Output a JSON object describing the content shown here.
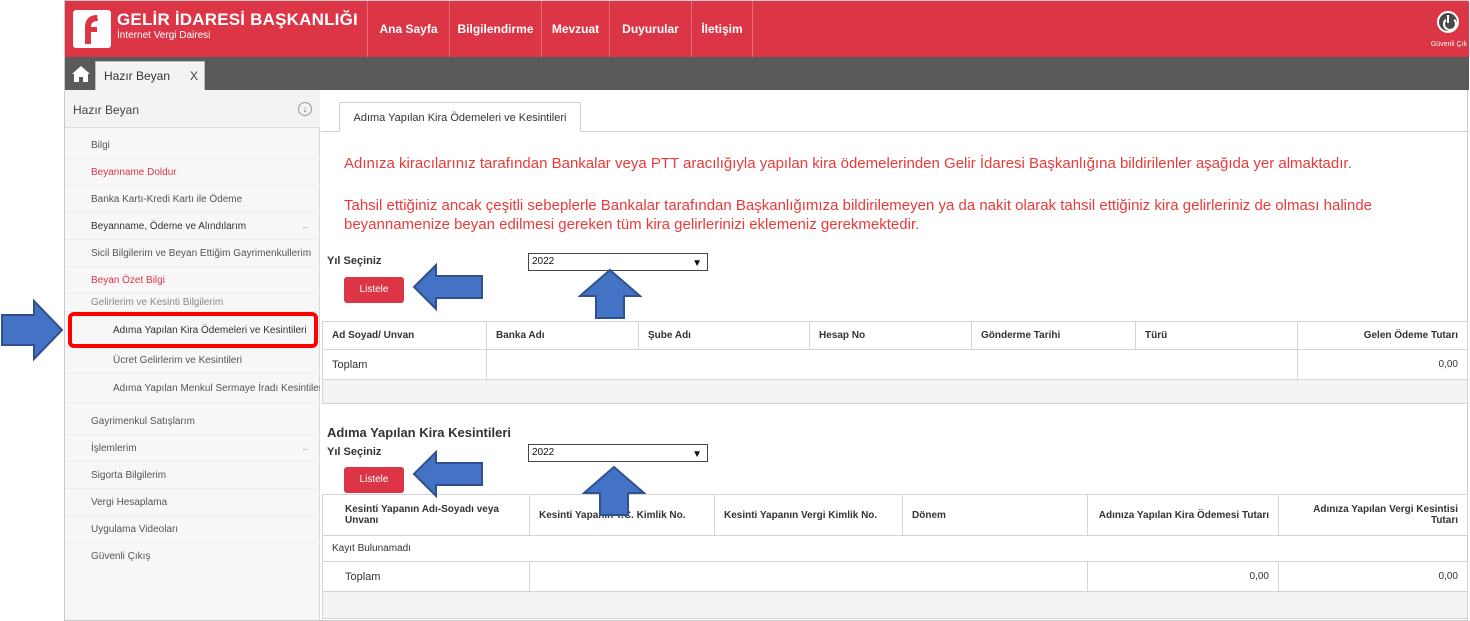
{
  "header": {
    "title": "GELİR İDARESİ BAŞKANLIĞI",
    "subtitle": "İnternet Vergi Dairesi",
    "nav": [
      "Ana Sayfa",
      "Bilgilendirme",
      "Mevzuat",
      "Duyurular",
      "İletişim"
    ],
    "logout_label": "Güvenli Çık",
    "accent_color": "#dc3545"
  },
  "tabbar": {
    "open_tab": "Hazır Beyan",
    "close": "X"
  },
  "sidebar": {
    "header": "Hazır Beyan",
    "items": [
      "Bilgi",
      "Beyanname Doldur",
      "Banka Kartı-Kredi Kartı ile Ödeme",
      "Beyanname, Ödeme ve Alındılarım",
      "Sicil Bilgilerim ve Beyan Ettiğim Gayrimenkullerim",
      "Beyan Özet Bilgi",
      "Gelirlerim ve Kesinti Bilgilerim",
      "Adıma Yapılan Kira Ödemeleri ve Kesintileri",
      "Ücret Gelirlerim ve Kesintileri",
      "Adıma Yapılan Menkul Sermaye İradı Kesintileri",
      "Gayrimenkul Satışlarım",
      "İşlemlerim",
      "Sigorta Bilgilerim",
      "Vergi Hesaplama",
      "Uygulama Videoları",
      "Güvenli Çıkış"
    ]
  },
  "main": {
    "tab": "Adıma Yapılan Kira Ödemeleri ve Kesintileri",
    "info1": "Adınıza kiracılarınız tarafından Bankalar veya PTT aracılığıyla yapılan kira ödemelerinden Gelir İdaresi Başkanlığına bildirilenler aşağıda yer almaktadır.",
    "info2": "Tahsil ettiğiniz ancak çeşitli sebeplerle Bankalar tarafından Başkanlığımıza bildirilemeyen ya da nakit olarak tahsil ettiğiniz kira gelirleriniz de olması halinde beyannamenize beyan edilmesi gereken tüm kira gelirlerinizi eklemeniz gerekmektedir.",
    "year_label": "Yıl Seçiniz",
    "year_value": "2022",
    "list_button": "Listele",
    "table1": {
      "headers": [
        "Ad Soyad/ Unvan",
        "Banka Adı",
        "Şube Adı",
        "Hesap No",
        "Gönderme Tarihi",
        "Türü",
        "Gelen Ödeme Tutarı"
      ],
      "total_label": "Toplam",
      "total_value": "0,00"
    },
    "section2_title": "Adıma Yapılan Kira Kesintileri",
    "table2": {
      "headers": [
        "Kesinti Yapanın Adı-Soyadı veya Unvanı",
        "Kesinti Yapanın T.C. Kimlik No.",
        "Kesinti Yapanın Vergi Kimlik No.",
        "Dönem",
        "Adınıza Yapılan Kira Ödemesi Tutarı",
        "Adınıza Yapılan Vergi Kesintisi Tutarı"
      ],
      "empty": "Kayıt Bulunamadı",
      "total_label": "Toplam",
      "total_values": [
        "0,00",
        "0,00"
      ]
    }
  }
}
